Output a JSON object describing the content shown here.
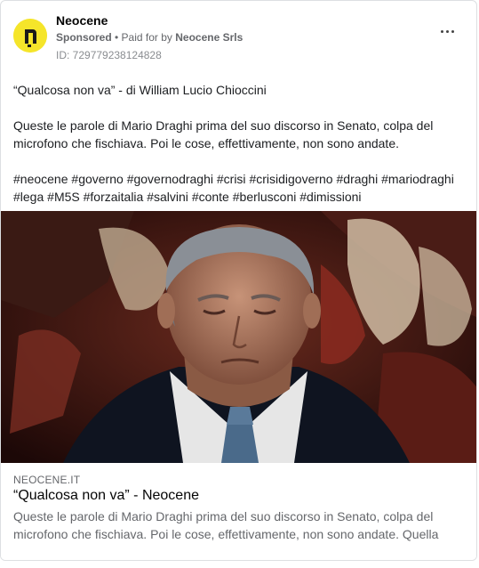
{
  "header": {
    "page_name": "Neocene",
    "sponsored_label": "Sponsored",
    "separator": " • ",
    "paid_for_by_label": "Paid for by ",
    "advertiser": "Neocene Srls",
    "ad_id": "ID: 729779238124828",
    "avatar_icon": "neocene-logo",
    "more_icon": "more-options-icon"
  },
  "post": {
    "title_line": "“Qualcosa non va” - di William Lucio Chioccini",
    "body": "Queste le parole di Mario Draghi prima del suo discorso in Senato, colpa del microfono che fischiava. Poi le cose, effettivamente, non sono andate.",
    "hashtags": [
      "#neocene",
      "#governo",
      "#governodraghi",
      "#crisi",
      "#crisidigoverno",
      "#draghi",
      "#mariodraghi",
      "#lega",
      "#M5S",
      "#forzaitalia",
      "#salvini",
      "#conte",
      "#berlusconi",
      "#dimissioni"
    ]
  },
  "link_preview": {
    "domain": "NEOCENE.IT",
    "title": "“Qualcosa non va” - Neocene",
    "description": "Queste le parole di Mario Draghi prima del suo discorso in Senato, colpa del microfono che fischiava. Poi le cose, effettivamente, non sono andate. Quella di…"
  },
  "colors": {
    "avatar_bg": "#f5e52a",
    "text_primary": "#1c1e21",
    "text_secondary": "#65676b"
  }
}
